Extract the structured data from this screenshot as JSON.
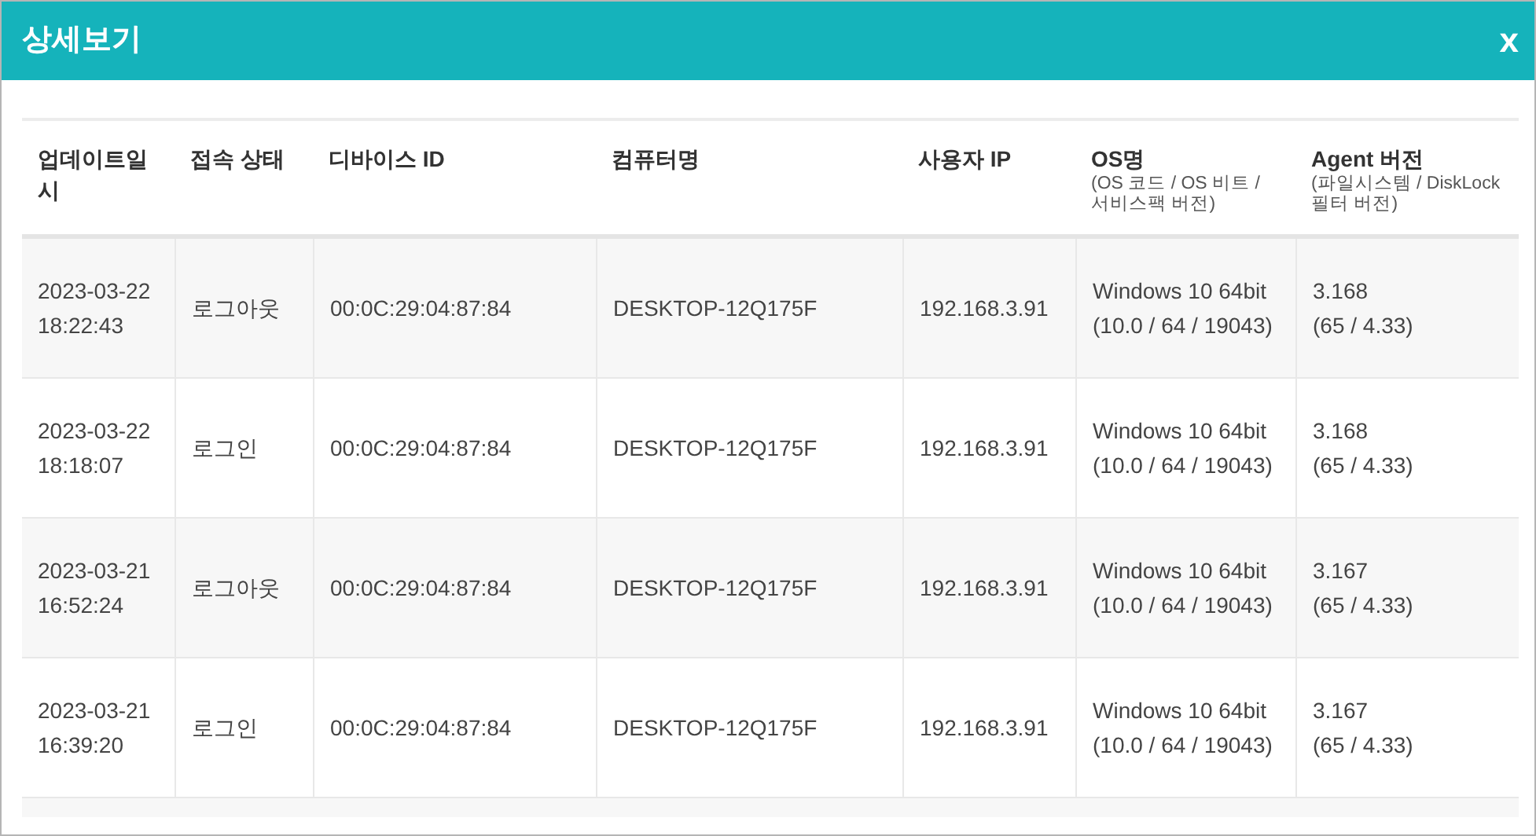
{
  "window": {
    "title": "상세보기",
    "close_label": "x"
  },
  "table": {
    "columns": [
      {
        "label": "업데이트일시"
      },
      {
        "label": "접속 상태"
      },
      {
        "label": "디바이스 ID"
      },
      {
        "label": "컴퓨터명"
      },
      {
        "label": "사용자 IP"
      },
      {
        "label": "OS명",
        "sub": "(OS 코드 / OS 비트 / 서비스팩 버전)"
      },
      {
        "label": "Agent 버전",
        "sub": "(파일시스템 / DiskLock 필터 버전)"
      }
    ],
    "rows": [
      {
        "updated": "2023-03-22 18:22:43",
        "status": "로그아웃",
        "device_id": "00:0C:29:04:87:84",
        "computer": "DESKTOP-12Q175F",
        "ip": "192.168.3.91",
        "os": "Windows 10 64bit",
        "os_detail": "(10.0 / 64 / 19043)",
        "agent": "3.168",
        "agent_detail": "(65 / 4.33)"
      },
      {
        "updated": "2023-03-22 18:18:07",
        "status": "로그인",
        "device_id": "00:0C:29:04:87:84",
        "computer": "DESKTOP-12Q175F",
        "ip": "192.168.3.91",
        "os": "Windows 10 64bit",
        "os_detail": "(10.0 / 64 / 19043)",
        "agent": "3.168",
        "agent_detail": "(65 / 4.33)"
      },
      {
        "updated": "2023-03-21 16:52:24",
        "status": "로그아웃",
        "device_id": "00:0C:29:04:87:84",
        "computer": "DESKTOP-12Q175F",
        "ip": "192.168.3.91",
        "os": "Windows 10 64bit",
        "os_detail": "(10.0 / 64 / 19043)",
        "agent": "3.167",
        "agent_detail": "(65 / 4.33)"
      },
      {
        "updated": "2023-03-21 16:39:20",
        "status": "로그인",
        "device_id": "00:0C:29:04:87:84",
        "computer": "DESKTOP-12Q175F",
        "ip": "192.168.3.91",
        "os": "Windows 10 64bit",
        "os_detail": "(10.0 / 64 / 19043)",
        "agent": "3.167",
        "agent_detail": "(65 / 4.33)"
      }
    ]
  }
}
